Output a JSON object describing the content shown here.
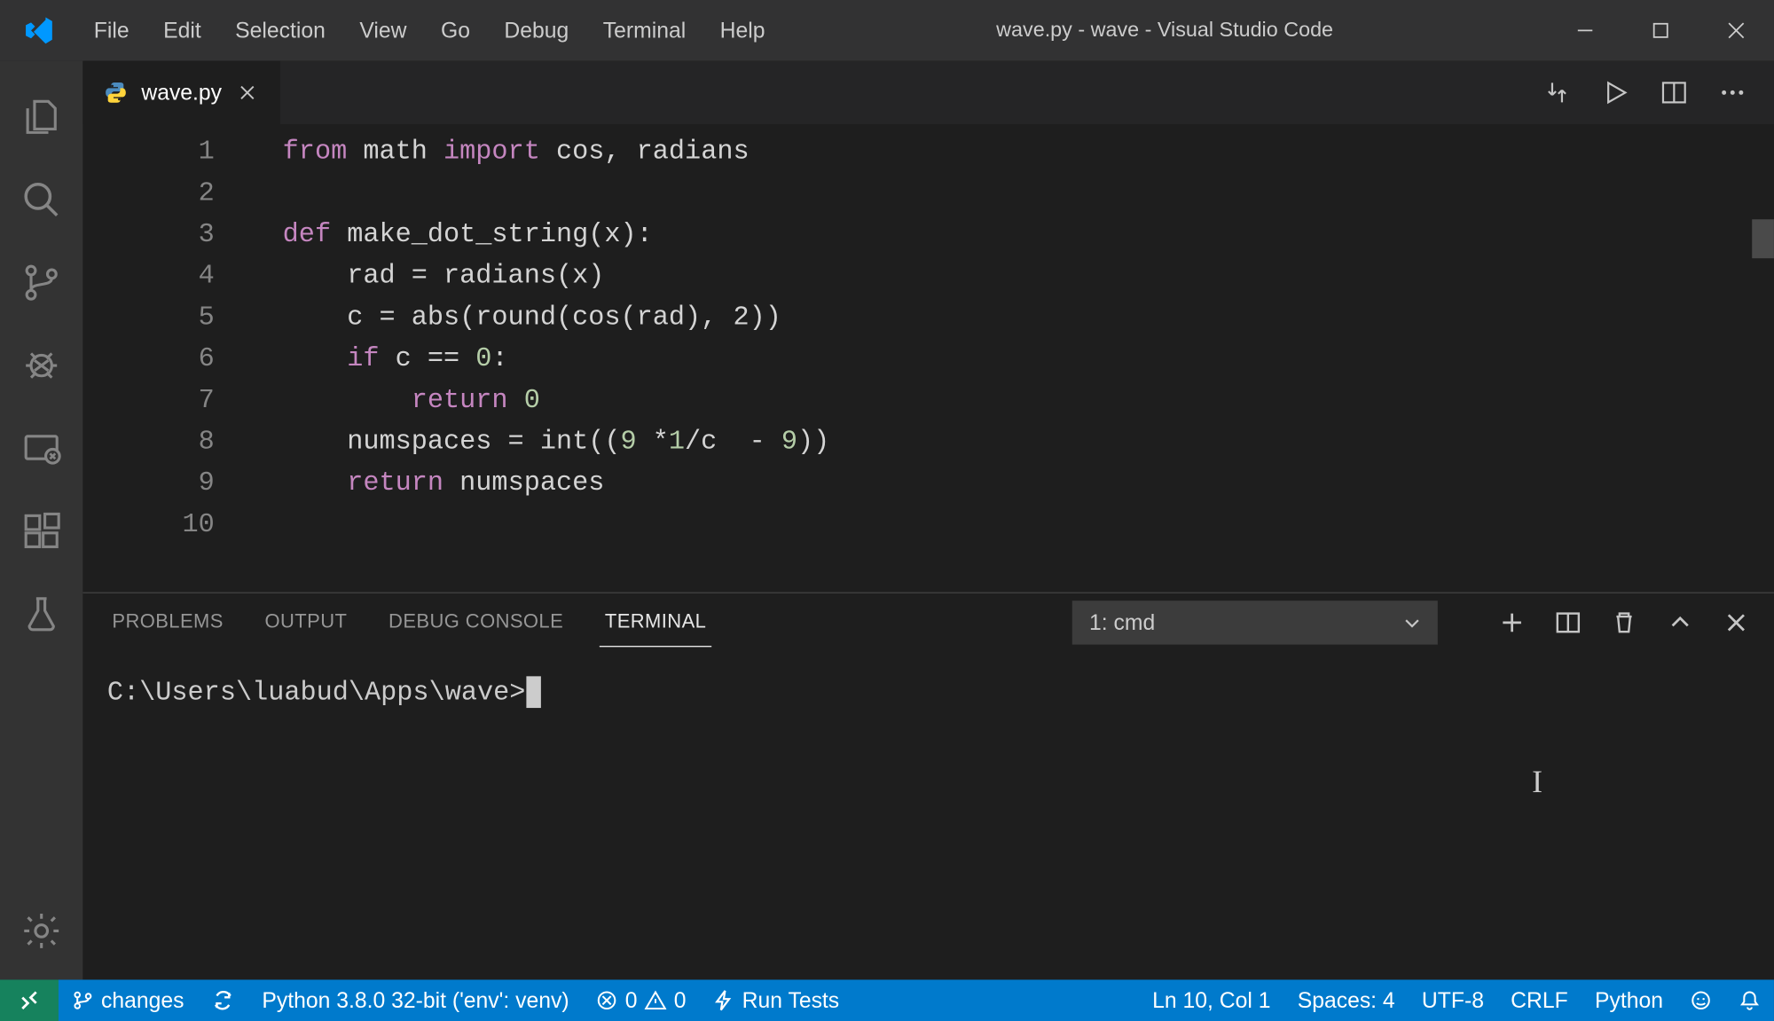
{
  "title_bar": {
    "menu": [
      "File",
      "Edit",
      "Selection",
      "View",
      "Go",
      "Debug",
      "Terminal",
      "Help"
    ],
    "window_title": "wave.py - wave - Visual Studio Code"
  },
  "tabs": {
    "items": [
      {
        "label": "wave.py",
        "icon": "python"
      }
    ]
  },
  "editor": {
    "line_numbers": [
      "1",
      "2",
      "3",
      "4",
      "5",
      "6",
      "7",
      "8",
      "9",
      "10"
    ],
    "code": [
      {
        "segments": [
          {
            "t": "from",
            "c": "tk-keyword"
          },
          {
            "t": " math ",
            "c": ""
          },
          {
            "t": "import",
            "c": "tk-keyword"
          },
          {
            "t": " cos, radians",
            "c": ""
          }
        ]
      },
      {
        "segments": []
      },
      {
        "segments": [
          {
            "t": "def",
            "c": "tk-keyword"
          },
          {
            "t": " make_dot_string(x):",
            "c": ""
          }
        ]
      },
      {
        "segments": [
          {
            "t": "    rad = radians(x)",
            "c": ""
          }
        ]
      },
      {
        "segments": [
          {
            "t": "    c = abs(round(cos(rad), 2))",
            "c": ""
          }
        ]
      },
      {
        "segments": [
          {
            "t": "    ",
            "c": ""
          },
          {
            "t": "if",
            "c": "tk-keyword"
          },
          {
            "t": " c == ",
            "c": ""
          },
          {
            "t": "0",
            "c": "tk-num"
          },
          {
            "t": ":",
            "c": ""
          }
        ]
      },
      {
        "segments": [
          {
            "t": "        ",
            "c": ""
          },
          {
            "t": "return",
            "c": "tk-keyword"
          },
          {
            "t": " ",
            "c": ""
          },
          {
            "t": "0",
            "c": "tk-num"
          }
        ]
      },
      {
        "segments": [
          {
            "t": "    numspaces = int((",
            "c": ""
          },
          {
            "t": "9",
            "c": "tk-num"
          },
          {
            "t": " *",
            "c": ""
          },
          {
            "t": "1",
            "c": "tk-num"
          },
          {
            "t": "/c  - ",
            "c": ""
          },
          {
            "t": "9",
            "c": "tk-num"
          },
          {
            "t": "))",
            "c": ""
          }
        ]
      },
      {
        "segments": [
          {
            "t": "    ",
            "c": ""
          },
          {
            "t": "return",
            "c": "tk-keyword"
          },
          {
            "t": " numspaces",
            "c": ""
          }
        ]
      },
      {
        "segments": []
      }
    ]
  },
  "panel": {
    "tabs": [
      "PROBLEMS",
      "OUTPUT",
      "DEBUG CONSOLE",
      "TERMINAL"
    ],
    "active_tab": "TERMINAL",
    "dropdown_value": "1: cmd",
    "terminal_prompt": "C:\\Users\\luabud\\Apps\\wave>"
  },
  "status_bar": {
    "branch": "changes",
    "python_env": "Python 3.8.0 32-bit ('env': venv)",
    "errors": "0",
    "warnings": "0",
    "run_tests": "Run Tests",
    "position": "Ln 10, Col 1",
    "indent": "Spaces: 4",
    "encoding": "UTF-8",
    "eol": "CRLF",
    "language": "Python"
  }
}
